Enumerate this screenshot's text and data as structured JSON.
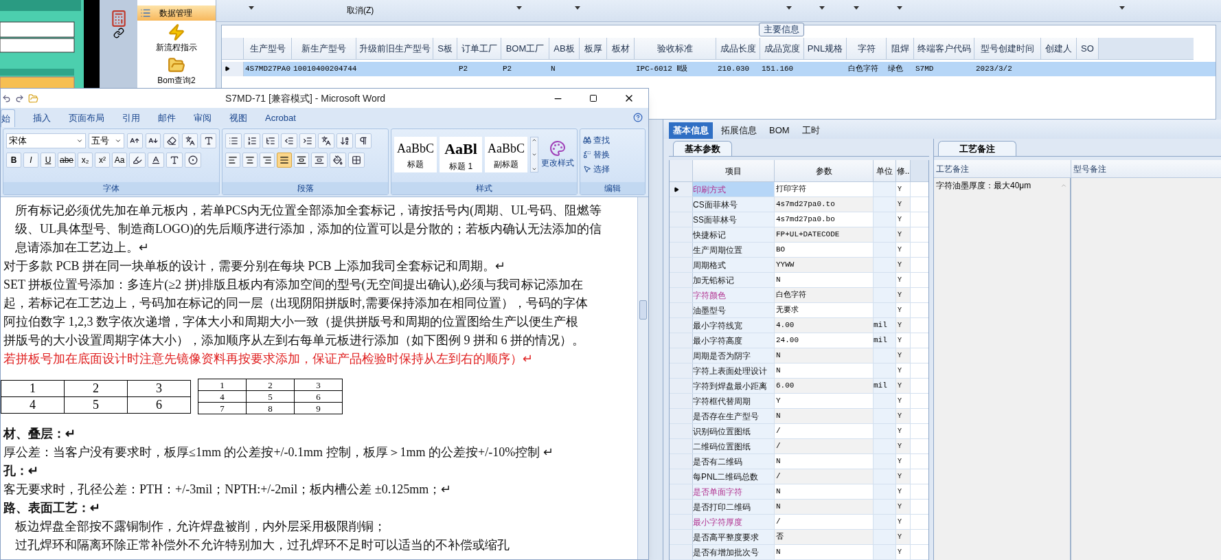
{
  "nav": {
    "items": [
      {
        "label": "数据管理",
        "selected": true
      },
      {
        "label": "新流程指示",
        "selected": false
      },
      {
        "label": "Bom查询2",
        "selected": false
      }
    ]
  },
  "toolbar": {
    "cancel": "取消(Z)"
  },
  "main_info": {
    "title": "主要信息",
    "columns": [
      "生产型号",
      "新生产型号",
      "升级前旧生产型号",
      "S板",
      "订单工厂",
      "BOM工厂",
      "AB板",
      "板厚",
      "板材",
      "验收标准",
      "成品长度",
      "成品宽度",
      "PNL规格",
      "字符",
      "阻焊",
      "终端客户代码",
      "型号创建时间",
      "创建人",
      "SO"
    ],
    "rows": [
      {
        "selected": true,
        "cells": [
          "4S7MD27PA0",
          "10010400204744",
          null,
          null,
          "P2",
          "P2",
          "N",
          null,
          null,
          "IPC-6012 Ⅱ级",
          "210.030",
          "151.160",
          null,
          "白色字符",
          "绿色",
          "S7MD",
          "2023/3/2",
          null,
          null
        ]
      }
    ]
  },
  "word": {
    "title": "S7MD-71 [兼容模式] - Microsoft Word",
    "tabs": [
      {
        "label": "始",
        "selected": true
      },
      {
        "label": "插入",
        "selected": false
      },
      {
        "label": "页面布局",
        "selected": false
      },
      {
        "label": "引用",
        "selected": false
      },
      {
        "label": "邮件",
        "selected": false
      },
      {
        "label": "审阅",
        "selected": false
      },
      {
        "label": "视图",
        "selected": false
      },
      {
        "label": "Acrobat",
        "selected": false
      }
    ],
    "font_name": "宋体",
    "font_size": "五号",
    "format_buttons": [
      "B",
      "I",
      "U",
      "abe",
      "x₂",
      "x²",
      "Aa"
    ],
    "align_buttons": [
      {
        "selected": false
      },
      {
        "selected": false
      },
      {
        "selected": false
      },
      {
        "selected": true
      },
      {
        "selected": false
      }
    ],
    "styles": [
      {
        "preview": "AaBbC",
        "label": "标题"
      },
      {
        "preview": "AaBl",
        "label": "标题 1"
      },
      {
        "preview": "AaBbC",
        "label": "副标题"
      }
    ],
    "change_styles": "更改样式",
    "edit_items": [
      "查找",
      "替换",
      "选择"
    ],
    "groups": [
      "字体",
      "段落",
      "样式",
      "编辑"
    ],
    "doc": [
      {
        "kind": "text",
        "indent": true,
        "text": "所有标记必须优先加在单元板内，若单PCS内无位置全部添加全套标记，请按括号内(周期、UL号码、阻燃等"
      },
      {
        "kind": "text",
        "indent": true,
        "text": "级、UL具体型号、制造商LOGO)的先后顺序进行添加，添加的位置可以是分散的；若板内确认无法添加的信"
      },
      {
        "kind": "text",
        "indent": true,
        "text": "息请添加在工艺边上。↵"
      },
      {
        "kind": "text",
        "indent": false,
        "text": "对于多款 PCB 拼在同一块单板的设计，需要分别在每块 PCB 上添加我司全套标记和周期。↵"
      },
      {
        "kind": "text",
        "indent": false,
        "text": "SET 拼板位置号添加：多连片(≥2 拼)排版且板内有添加空间的型号(无空间提出确认),必须与我司标记添加在"
      },
      {
        "kind": "text",
        "indent": false,
        "text": "起，若标记在工艺边上，号码加在标记的同一层（出现阴阳拼版时,需要保持添加在相同位置），号码的字体"
      },
      {
        "kind": "text",
        "indent": false,
        "text": "阿拉伯数字 1,2,3 数字依次递增，字体大小和周期大小一致（提供拼版号和周期的位置图给生产以便生产根"
      },
      {
        "kind": "text",
        "indent": false,
        "text": "拼版号的大小设置周期字体大小），添加顺序从左到右每单元板进行添加（如下图例 9 拼和 6 拼的情况）。"
      },
      {
        "kind": "red",
        "indent": false,
        "text": "若拼板号加在底面设计时注意先镜像资料再按要求添加，保证产品检验时保持从左到右的顺序）↵"
      },
      {
        "kind": "tables",
        "tables": [
          [
            [
              "1",
              "2",
              "3"
            ],
            [
              "4",
              "5",
              "6"
            ]
          ],
          [
            [
              "1",
              "2",
              "3"
            ],
            [
              "4",
              "5",
              "6"
            ],
            [
              "7",
              "8",
              "9"
            ]
          ]
        ]
      },
      {
        "kind": "heading",
        "indent": false,
        "text": "材、叠层：↵"
      },
      {
        "kind": "text",
        "indent": false,
        "text": "厚公差：当客户没有要求时，板厚≤1mm 的公差按+/-0.1mm 控制，板厚＞1mm 的公差按+/-10%控制 ↵"
      },
      {
        "kind": "heading",
        "indent": false,
        "text": "孔：↵"
      },
      {
        "kind": "text",
        "indent": false,
        "text": "客无要求时，孔径公差：PTH：+/-3mil；NPTH:+/-2mil；板内槽公差 ±0.125mm；↵"
      },
      {
        "kind": "heading",
        "indent": false,
        "text": "路、表面工艺：↵"
      },
      {
        "kind": "text",
        "indent": true,
        "text": "板边焊盘全部按不露铜制作，允许焊盘被削，内外层采用极限削铜；"
      },
      {
        "kind": "text",
        "indent": true,
        "text": "过孔焊环和隔离环除正常补偿外不允许特别加大，过孔焊环不足时可以适当的不补偿或缩孔"
      }
    ]
  },
  "detail": {
    "tabs": [
      {
        "label": "基本信息",
        "selected": true
      },
      {
        "label": "拓展信息",
        "selected": false
      },
      {
        "label": "BOM",
        "selected": false
      },
      {
        "label": "工时",
        "selected": false
      }
    ],
    "params_tab": "基本参数",
    "param_columns": [
      "项目",
      "参数",
      "单位",
      "修.."
    ],
    "params": [
      {
        "item": "印刷方式",
        "value": "打印字符",
        "flag": "Y",
        "emphasized": true,
        "selected": true
      },
      {
        "item": "CS面菲林号",
        "value": "4s7md27pa0.to",
        "flag": "Y",
        "emphasized": false,
        "selected": false
      },
      {
        "item": "SS面菲林号",
        "value": "4s7md27pa0.bo",
        "flag": "Y",
        "emphasized": false,
        "selected": false
      },
      {
        "item": "快捷标记",
        "value": "FP+UL+DATECODE",
        "flag": "Y",
        "emphasized": false,
        "selected": false
      },
      {
        "item": "生产周期位置",
        "value": "BO",
        "flag": "Y",
        "emphasized": false,
        "selected": false
      },
      {
        "item": "周期格式",
        "value": "YYWW",
        "flag": "Y",
        "emphasized": false,
        "selected": false
      },
      {
        "item": "加无铅标记",
        "value": "N",
        "flag": "Y",
        "emphasized": false,
        "selected": false
      },
      {
        "item": "字符颜色",
        "value": "白色字符",
        "flag": "Y",
        "emphasized": true,
        "selected": false
      },
      {
        "item": "油墨型号",
        "value": "无要求",
        "flag": "Y",
        "emphasized": false,
        "selected": false
      },
      {
        "item": "最小字符线宽",
        "value": "4.00",
        "unit": "mil",
        "flag": "Y",
        "emphasized": false,
        "selected": false
      },
      {
        "item": "最小字符高度",
        "value": "24.00",
        "unit": "mil",
        "flag": "Y",
        "emphasized": false,
        "selected": false
      },
      {
        "item": "周期是否为阴字",
        "value": "N",
        "flag": "Y",
        "emphasized": false,
        "selected": false
      },
      {
        "item": "字符上表面处理设计",
        "value": "N",
        "flag": "Y",
        "emphasized": false,
        "selected": false
      },
      {
        "item": "字符到焊盘最小距离",
        "value": "6.00",
        "unit": "mil",
        "flag": "Y",
        "emphasized": false,
        "selected": false
      },
      {
        "item": "字符框代替周期",
        "value": "Y",
        "flag": "Y",
        "emphasized": false,
        "selected": false
      },
      {
        "item": "是否存在生产型号",
        "value": "N",
        "flag": "Y",
        "emphasized": false,
        "selected": false
      },
      {
        "item": "识别码位置图纸",
        "value": "/",
        "flag": "Y",
        "emphasized": false,
        "selected": false
      },
      {
        "item": "二维码位置图纸",
        "value": "/",
        "flag": "Y",
        "emphasized": false,
        "selected": false
      },
      {
        "item": "是否有二维码",
        "value": "N",
        "flag": "Y",
        "emphasized": false,
        "selected": false
      },
      {
        "item": "每PNL二维码总数",
        "value": "/",
        "flag": "Y",
        "emphasized": false,
        "selected": false
      },
      {
        "item": "是否单面字符",
        "value": "N",
        "flag": "Y",
        "emphasized": true,
        "selected": false
      },
      {
        "item": "是否打印二维码",
        "value": "N",
        "flag": "Y",
        "emphasized": false,
        "selected": false
      },
      {
        "item": "最小字符厚度",
        "value": "/",
        "flag": "Y",
        "emphasized": true,
        "selected": false
      },
      {
        "item": "是否高平整度要求",
        "value": "否",
        "flag": "Y",
        "emphasized": false,
        "selected": false
      },
      {
        "item": "是否有增加批次号",
        "value": "N",
        "flag": "Y",
        "emphasized": false,
        "selected": false
      }
    ],
    "notes_tab": "工艺备注",
    "notes_columns": [
      "工艺备注",
      "型号备注"
    ],
    "notes": "字符油墨厚度：最大40μm"
  }
}
